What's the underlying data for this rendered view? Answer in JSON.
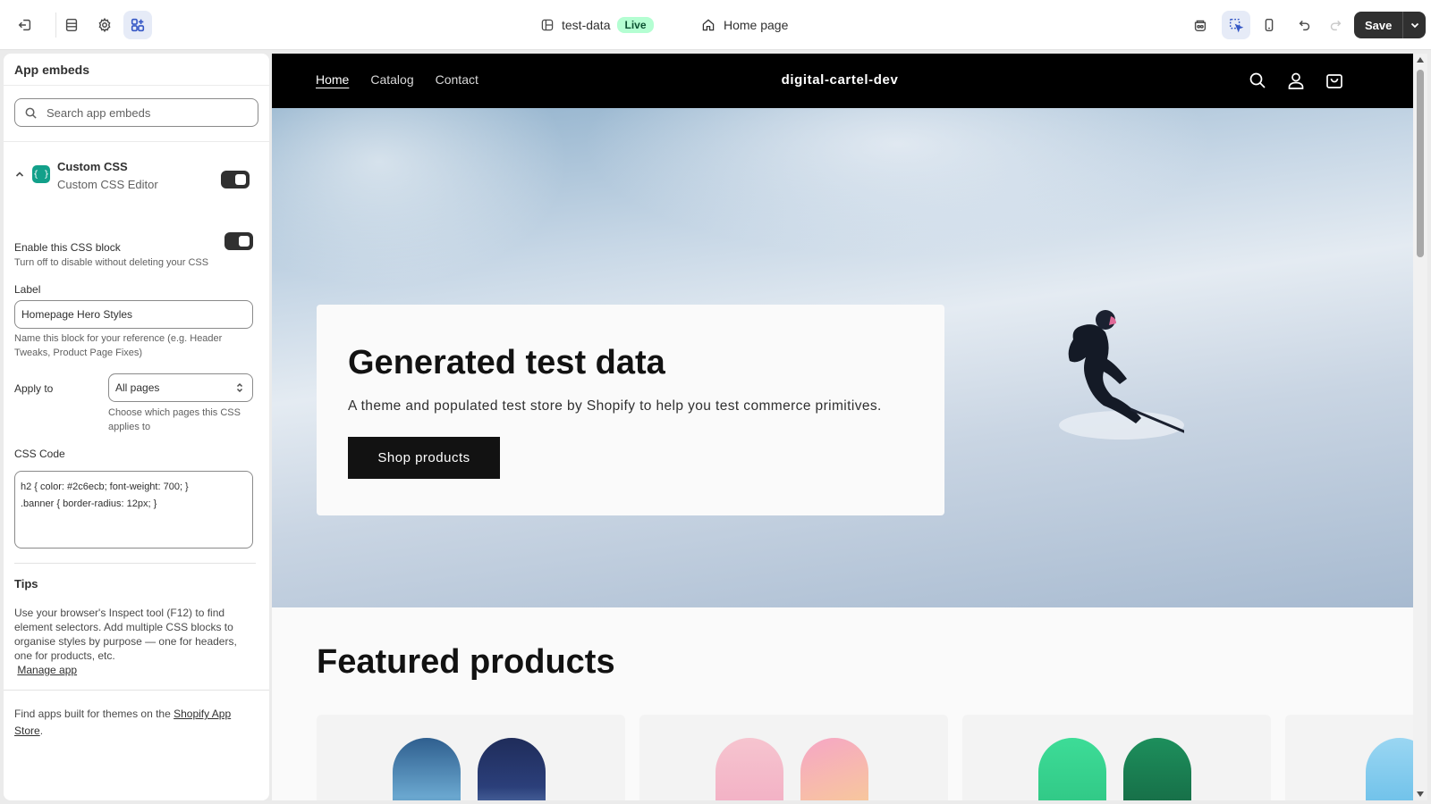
{
  "topbar": {
    "theme_name": "test-data",
    "theme_status": "Live",
    "page_name": "Home page",
    "save_label": "Save"
  },
  "panel": {
    "title": "App embeds",
    "search_placeholder": "Search app embeds",
    "app": {
      "name": "Custom CSS",
      "block": "Custom CSS Editor",
      "icon": "{ }",
      "enabled": true
    },
    "enable_label": "Enable this CSS block",
    "enable_help": "Turn off to disable without deleting your CSS",
    "label_label": "Label",
    "label_value": "Homepage Hero Styles",
    "label_help": "Name this block for your reference (e.g. Header Tweaks, Product Page Fixes)",
    "apply_label": "Apply to",
    "apply_value": "All pages",
    "apply_help": "Choose which pages this CSS applies to",
    "css_label": "CSS Code",
    "css_line1": "h2 { color: #2c6ecb; font-weight: 700; }",
    "css_line2": ".banner { border-radius: 12px; }",
    "tips_title": "Tips",
    "tips_text": "Use your browser's Inspect tool (F12) to find element selectors. Add multiple CSS blocks to organise styles by purpose — one for headers, one for products, etc.",
    "manage_link": "Manage app",
    "footer_prefix": "Find apps built for themes on the ",
    "footer_link": "Shopify App Store",
    "footer_suffix": "."
  },
  "store": {
    "nav": [
      "Home",
      "Catalog",
      "Contact"
    ],
    "name": "digital-cartel-dev",
    "hero_title": "Generated test data",
    "hero_subtitle": "A theme and populated test store by Shopify to help you test commerce primitives.",
    "hero_button": "Shop products",
    "featured_title": "Featured products"
  },
  "colors": {
    "accent": "#303030",
    "live_badge": "#b4fed2",
    "active_tool": "#e6ebf7"
  }
}
